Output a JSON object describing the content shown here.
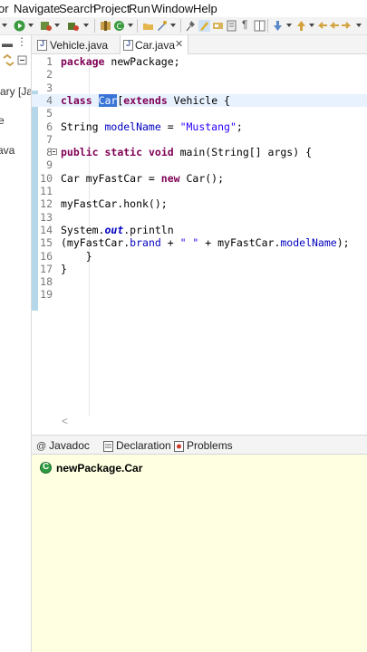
{
  "menubar": {
    "items": [
      "or",
      "Navigate",
      "Search",
      "Project",
      "Run",
      "Window",
      "Help"
    ]
  },
  "left_panel": {
    "fragments": [
      "rary [Ja",
      "e",
      "ava"
    ]
  },
  "editor_tabs": [
    {
      "label": "Vehicle.java",
      "active": false
    },
    {
      "label": "Car.java",
      "active": true,
      "close": "✕"
    }
  ],
  "editor": {
    "lines": [
      {
        "n": "1",
        "tokens": [
          {
            "t": "package",
            "c": "kw"
          },
          {
            "t": " newPackage;",
            "c": ""
          }
        ]
      },
      {
        "n": "2",
        "tokens": []
      },
      {
        "n": "3",
        "tokens": []
      },
      {
        "n": "4",
        "current": true,
        "tokens": [
          {
            "t": "class",
            "c": "kw"
          },
          {
            "t": " ",
            "c": ""
          },
          {
            "t": "Car",
            "c": "sel"
          },
          {
            "t": "[",
            "c": ""
          },
          {
            "t": "extends",
            "c": "kw"
          },
          {
            "t": " Vehicle {",
            "c": ""
          }
        ]
      },
      {
        "n": "5",
        "tokens": []
      },
      {
        "n": "6",
        "tokens": [
          {
            "t": "String ",
            "c": ""
          },
          {
            "t": "modelName",
            "c": "fld"
          },
          {
            "t": " = ",
            "c": ""
          },
          {
            "t": "\"Mustang\"",
            "c": "str"
          },
          {
            "t": ";",
            "c": ""
          }
        ]
      },
      {
        "n": "7",
        "tokens": []
      },
      {
        "n": "8",
        "fold": true,
        "tokens": [
          {
            "t": "public",
            "c": "kw"
          },
          {
            "t": " ",
            "c": ""
          },
          {
            "t": "static",
            "c": "kw"
          },
          {
            "t": " ",
            "c": ""
          },
          {
            "t": "void",
            "c": "kw"
          },
          {
            "t": " main(String[] args) {",
            "c": ""
          }
        ]
      },
      {
        "n": "9",
        "tokens": []
      },
      {
        "n": "10",
        "tokens": [
          {
            "t": "Car myFastCar = ",
            "c": ""
          },
          {
            "t": "new",
            "c": "kw"
          },
          {
            "t": " Car();",
            "c": ""
          }
        ]
      },
      {
        "n": "11",
        "tokens": []
      },
      {
        "n": "12",
        "tokens": [
          {
            "t": "myFastCar.honk();",
            "c": ""
          }
        ]
      },
      {
        "n": "13",
        "tokens": []
      },
      {
        "n": "14",
        "tokens": [
          {
            "t": "System.",
            "c": ""
          },
          {
            "t": "out",
            "c": "ital"
          },
          {
            "t": ".println",
            "c": ""
          }
        ]
      },
      {
        "n": "15",
        "tokens": [
          {
            "t": "(myFastCar.",
            "c": ""
          },
          {
            "t": "brand",
            "c": "fld"
          },
          {
            "t": " + ",
            "c": ""
          },
          {
            "t": "\" \"",
            "c": "str"
          },
          {
            "t": " + myFastCar.",
            "c": ""
          },
          {
            "t": "modelName",
            "c": "fld"
          },
          {
            "t": ");",
            "c": ""
          }
        ]
      },
      {
        "n": "16",
        "tokens": [
          {
            "t": "    }",
            "c": ""
          }
        ]
      },
      {
        "n": "17",
        "tokens": [
          {
            "t": "}",
            "c": ""
          }
        ]
      },
      {
        "n": "18",
        "tokens": []
      },
      {
        "n": "19",
        "tokens": []
      }
    ]
  },
  "bottom_tabs": [
    {
      "label": "Javadoc",
      "icon": "at-icon"
    },
    {
      "label": "Declaration",
      "icon": "declaration-icon"
    },
    {
      "label": "Problems",
      "icon": "problems-icon"
    }
  ],
  "javadoc": {
    "title": "newPackage.Car",
    "icon": "class-icon"
  },
  "colors": {
    "keyword": "#7f0055",
    "string": "#2a00ff",
    "field": "#0000c0",
    "selection": "#3875d7",
    "current_line": "#e8f2fe",
    "javadoc_bg": "#ffffe1"
  }
}
